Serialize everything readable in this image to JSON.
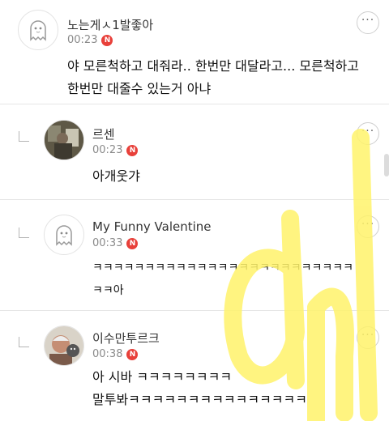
{
  "comments": [
    {
      "author": "노는게ㅅ1발좋아",
      "time": "00:23",
      "badge": "N",
      "lines": [
        "야 모른척하고 대줘라.. 한번만 대달라고... 모른척하고",
        "한번만 대줄수 있는거 아냐"
      ],
      "avatar_icon": "ghost-icon"
    },
    {
      "author": "르센",
      "time": "00:23",
      "badge": "N",
      "lines": [
        "아개웃갸"
      ],
      "avatar_icon": "photo-avatar-icon"
    },
    {
      "author": "My Funny Valentine",
      "time": "00:33",
      "badge": "N",
      "lines": [
        "ㅋㅋㅋㅋㅋㅋㅋㅋㅋㅋㅋㅋㅋㅋㅋㅋㅋㅋㅋㅋㅋㅋㅋㅋㅋ",
        "ㅋㅋ아"
      ],
      "avatar_icon": "ghost-icon"
    },
    {
      "author": "이수만투르크",
      "time": "00:38",
      "badge": "N",
      "lines": [
        "아 시바 ㅋㅋㅋㅋㅋㅋㅋㅋ",
        "말투봐ㅋㅋㅋㅋㅋㅋㅋㅋㅋㅋㅋㅋㅋㅋㅋ"
      ],
      "avatar_icon": "photo-avatar-icon"
    }
  ],
  "more_label": "···",
  "colors": {
    "badge": "#e8403a",
    "watermark": "#fff36b"
  }
}
